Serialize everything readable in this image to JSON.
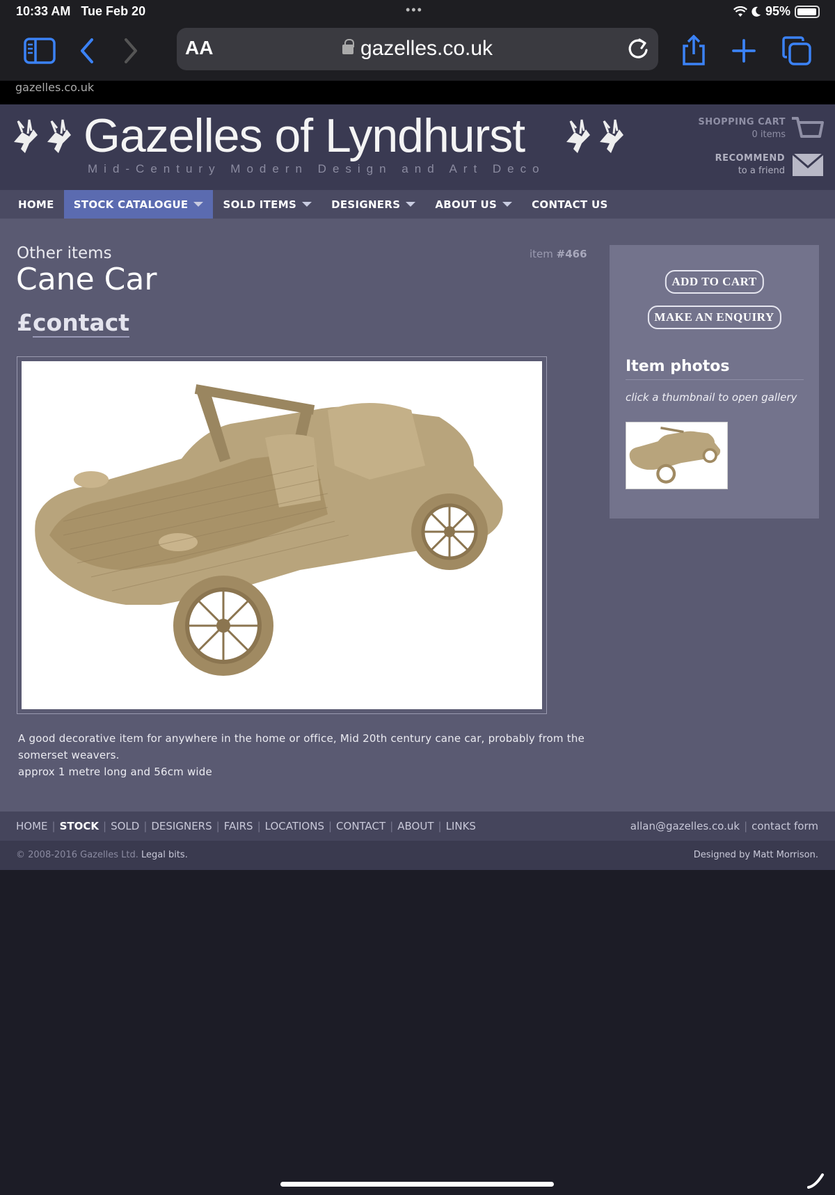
{
  "status": {
    "time": "10:33 AM",
    "date": "Tue Feb 20",
    "battery": "95%"
  },
  "browser": {
    "aa": "AA",
    "domain": "gazelles.co.uk",
    "page_label": "gazelles.co.uk"
  },
  "site": {
    "title": "Gazelles of Lyndhurst",
    "tagline": "Mid-Century Modern Design and Art Deco",
    "cart_heading": "SHOPPING CART",
    "cart_count": "0 items",
    "recommend_heading": "RECOMMEND",
    "recommend_sub": "to a friend"
  },
  "nav": {
    "home": "HOME",
    "stock": "STOCK CATALOGUE",
    "sold": "SOLD ITEMS",
    "designers": "DESIGNERS",
    "about": "ABOUT US",
    "contact": "CONTACT US"
  },
  "item": {
    "category": "Other items",
    "number_label": "item",
    "number": "#466",
    "title": "Cane Car",
    "price_symbol": "£",
    "price_text": "contact",
    "description_1": "A good decorative item for anywhere in the home or office, Mid 20th century cane car, probably from the somerset weavers.",
    "description_2": "approx 1 metre long and 56cm wide"
  },
  "sidebar": {
    "add_to_cart": "ADD TO CART",
    "enquiry": "MAKE AN ENQUIRY",
    "photos_heading": "Item photos",
    "photos_hint": "click a thumbnail to open gallery"
  },
  "footer": {
    "links": [
      "HOME",
      "STOCK",
      "SOLD",
      "DESIGNERS",
      "FAIRS",
      "LOCATIONS",
      "CONTACT",
      "ABOUT",
      "LINKS"
    ],
    "email": "allan@gazelles.co.uk",
    "contact_form": "contact form",
    "copyright": "© 2008-2016 Gazelles Ltd.",
    "legal": "Legal bits.",
    "designed_by": "Designed by Matt Morrison."
  },
  "colors": {
    "accent": "#5b6bb0",
    "header": "#3a3a52",
    "content": "#5a5a72",
    "toolbar_icon": "#3b82f6"
  }
}
